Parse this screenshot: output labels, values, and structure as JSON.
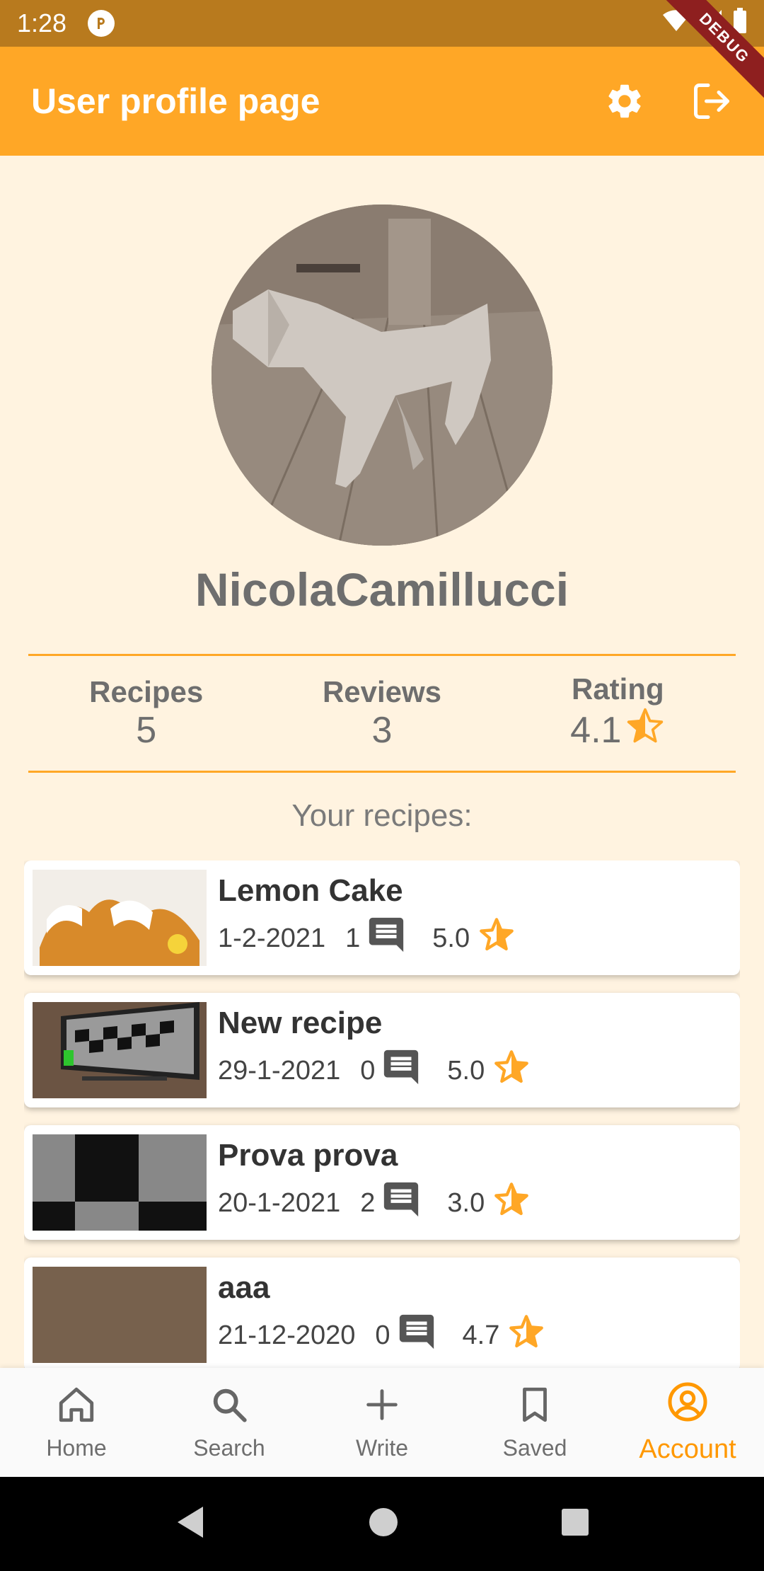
{
  "status_bar": {
    "time": "1:28"
  },
  "debug_banner": "DEBUG",
  "app_bar": {
    "title": "User profile page"
  },
  "profile": {
    "username": "NicolaCamillucci"
  },
  "stats": {
    "recipes_label": "Recipes",
    "recipes_value": "5",
    "reviews_label": "Reviews",
    "reviews_value": "3",
    "rating_label": "Rating",
    "rating_value": "4.1"
  },
  "recipes_section": {
    "title": "Your recipes:",
    "items": [
      {
        "title": "Lemon Cake",
        "date": "1-2-2021",
        "comments": "1",
        "rating": "5.0"
      },
      {
        "title": "New recipe",
        "date": "29-1-2021",
        "comments": "0",
        "rating": "5.0"
      },
      {
        "title": "Prova prova",
        "date": "20-1-2021",
        "comments": "2",
        "rating": "3.0"
      },
      {
        "title": "aaa",
        "date": "21-12-2020",
        "comments": "0",
        "rating": "4.7"
      }
    ]
  },
  "bottom_nav": {
    "home": "Home",
    "search": "Search",
    "write": "Write",
    "saved": "Saved",
    "account": "Account"
  },
  "colors": {
    "accent": "#FFA726",
    "status_bar": "#B87A1E",
    "background": "#FFF3E0",
    "active_nav": "#FF9800"
  }
}
